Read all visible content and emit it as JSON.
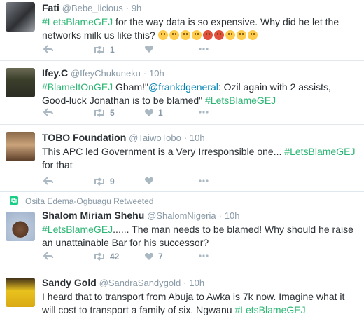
{
  "tweets": [
    {
      "name": "Fati",
      "handle": "@Bebe_licious",
      "time": "9h",
      "text_hashtag": "#LetsBlameGEJ",
      "text_rest": " for the way data is so expensive. Why did he let the networks milk us like this? ",
      "emoji_count": 9,
      "retweets": "1",
      "likes": ""
    },
    {
      "name": "Ifey.C",
      "handle": "@IfeyChukuneku",
      "time": "10h",
      "text_hashtag1": "#BlameItOnGEJ",
      "text_part1": " Gbam!\"",
      "text_mention": "@frankdgeneral",
      "text_part2": ": Ozil again with 2 assists, Good-luck Jonathan is to be blamed\" ",
      "text_hashtag2": "#LetsBlameGEJ",
      "retweets": "5",
      "likes": "1"
    },
    {
      "name": "TOBO Foundation",
      "handle": "@TaiwoTobo",
      "time": "10h",
      "text_part1": "This APC led Government is a Very Irresponsible one... ",
      "text_hashtag": "#LetsBlameGEJ",
      "text_part2": " for that",
      "retweets": "9",
      "likes": ""
    },
    {
      "retweet_context": "Osita Edema-Ogbuagu Retweeted",
      "name": "Shalom Miriam Shehu",
      "handle": "@ShalomNigeria",
      "time": "10h",
      "text_hashtag": "#LetsBlameGEJ",
      "text_rest": "......  The man needs to be blamed! Why should he raise an unattainable Bar for his successor?",
      "retweets": "42",
      "likes": "7"
    },
    {
      "name": "Sandy Gold",
      "handle": "@SandraSandygold",
      "time": "10h",
      "text_part1": "I heard that to transport from Abuja to Awka is 7k now. Imagine what it will cost to transport a family of six. Ngwanu ",
      "text_hashtag": "#LetsBlameGEJ"
    }
  ],
  "separator": "·",
  "colors": {
    "hashtag_green": "#2bb673",
    "mention_blue": "#0084b4",
    "muted_gray": "#8899a6",
    "action_gray": "#aab8c2",
    "retweet_green": "#19cf86"
  },
  "icons": [
    "reply-icon",
    "retweet-icon",
    "heart-icon",
    "retweeted-icon"
  ]
}
